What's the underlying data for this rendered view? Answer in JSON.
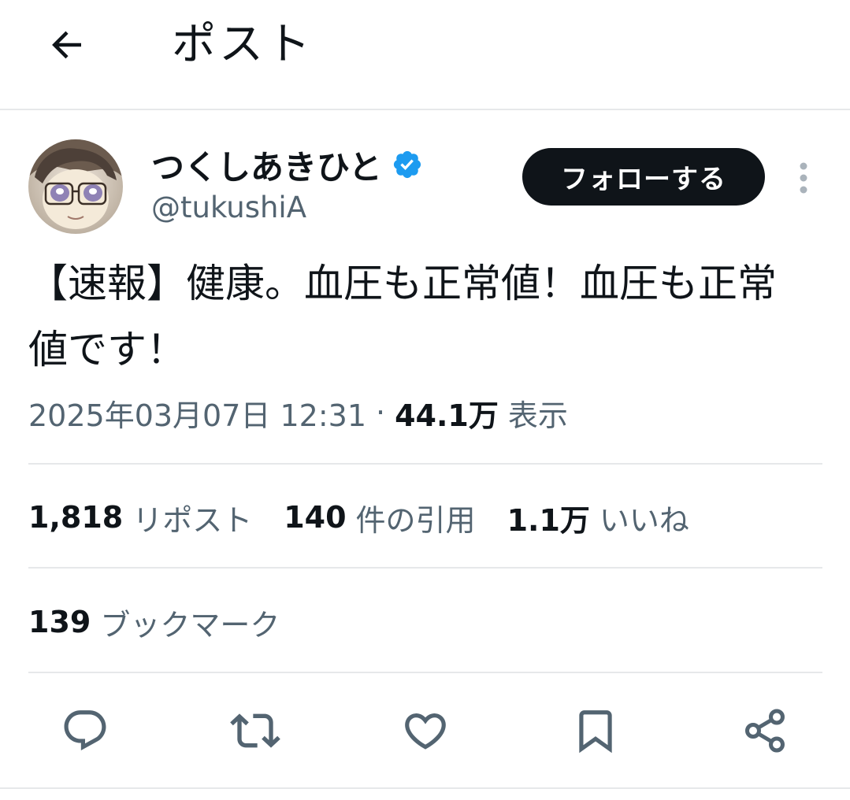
{
  "header": {
    "title": "ポスト",
    "back_icon": "arrow-left-icon"
  },
  "author": {
    "display_name": "つくしあきひと",
    "handle": "@tukushiA",
    "verified": true,
    "verified_color": "#1d9bf0"
  },
  "follow_button": {
    "label": "フォローする"
  },
  "tweet": {
    "text": "【速報】健康。血圧も正常値！血圧も正常値です！"
  },
  "meta": {
    "timestamp": "2025年03月07日 12:31",
    "separator": "·",
    "views_count": "44.1万",
    "views_label": "表示"
  },
  "stats": {
    "reposts_count": "1,818",
    "reposts_label": "リポスト",
    "quotes_count": "140",
    "quotes_label": "件の引用",
    "likes_count": "1.1万",
    "likes_label": "いいね"
  },
  "bookmarks": {
    "count": "139",
    "label": "ブックマーク"
  },
  "actions": [
    "reply-icon",
    "repost-icon",
    "like-icon",
    "bookmark-icon",
    "share-icon"
  ],
  "colors": {
    "text_primary": "#0f1419",
    "text_secondary": "#536471",
    "divider": "#e6e8ea",
    "follow_bg": "#0f1419",
    "icon_gray": "#536471"
  }
}
